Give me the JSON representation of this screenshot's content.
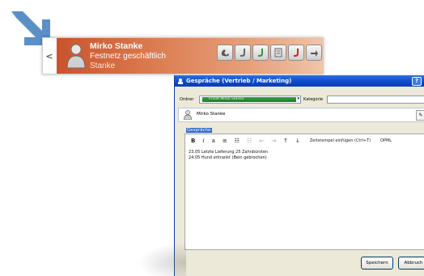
{
  "notification": {
    "prev_label": "<",
    "contact_name": "Mirko Stanke",
    "line2": "Festnetz geschäftlich",
    "line3": "Stanke",
    "buttons": [
      {
        "icon": "handset-icon"
      },
      {
        "icon": "call-icon"
      },
      {
        "icon": "call-green-icon"
      },
      {
        "icon": "notepad-icon"
      },
      {
        "icon": "hangup-icon"
      },
      {
        "icon": "transfer-icon"
      }
    ],
    "gradient_color": "#d86a3e"
  },
  "window": {
    "title": "Gespräche (Vertrieb / Marketing)",
    "help_label": "?",
    "ordner_label": "Ordner",
    "ordner_value": "Privat Mirko Stanke",
    "kategorie_label": "Kategorie",
    "kategorie_value": "",
    "contact_name": "Mirko Stanke",
    "subject": "Gespräche",
    "toolbar": {
      "bold": "B",
      "italic": "i",
      "underline": "a",
      "timestamp": "Zeitstempel einfügen (Ctrl+T)",
      "opml": "OPML"
    },
    "note_lines": [
      "23.05 Letzte Lieferung 25 Zahnbürsten",
      "24.05 Hund erkrankt (Bein gebrochen)"
    ],
    "save_label": "Speichern",
    "cancel_label": "Abbruch",
    "titlebar_color": "#0b47c9"
  },
  "accent_arrow_color": "#5b8fc8"
}
